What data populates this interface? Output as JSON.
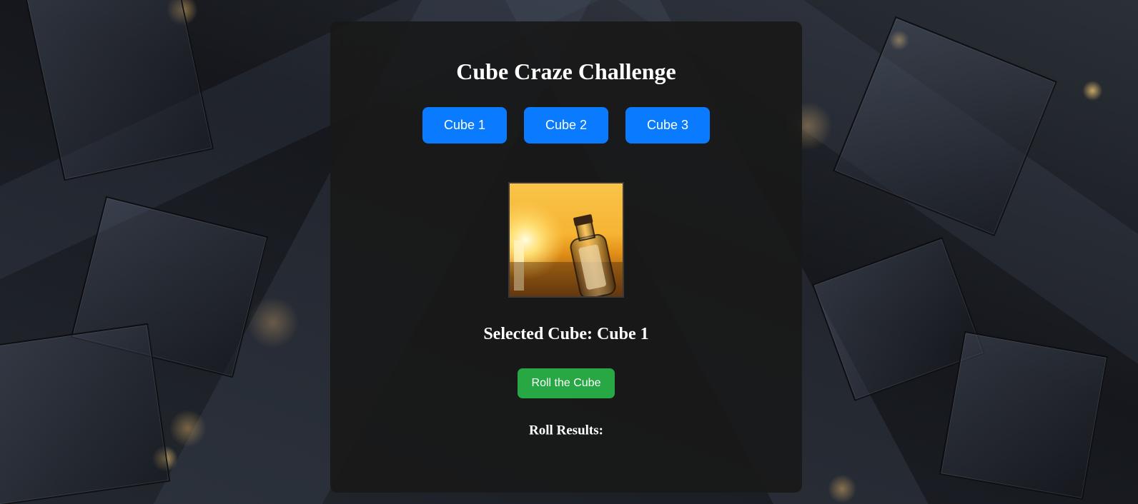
{
  "page": {
    "title": "Cube Craze Challenge"
  },
  "cubes": [
    {
      "label": "Cube 1"
    },
    {
      "label": "Cube 2"
    },
    {
      "label": "Cube 3"
    }
  ],
  "preview": {
    "image": "message-in-a-bottle-sunset-photo"
  },
  "selection": {
    "text": "Selected Cube: Cube 1"
  },
  "actions": {
    "roll_label": "Roll the Cube"
  },
  "results": {
    "heading": "Roll Results:"
  },
  "colors": {
    "cube_button": "#0a7bff",
    "roll_button": "#27a844",
    "panel": "#181818"
  }
}
